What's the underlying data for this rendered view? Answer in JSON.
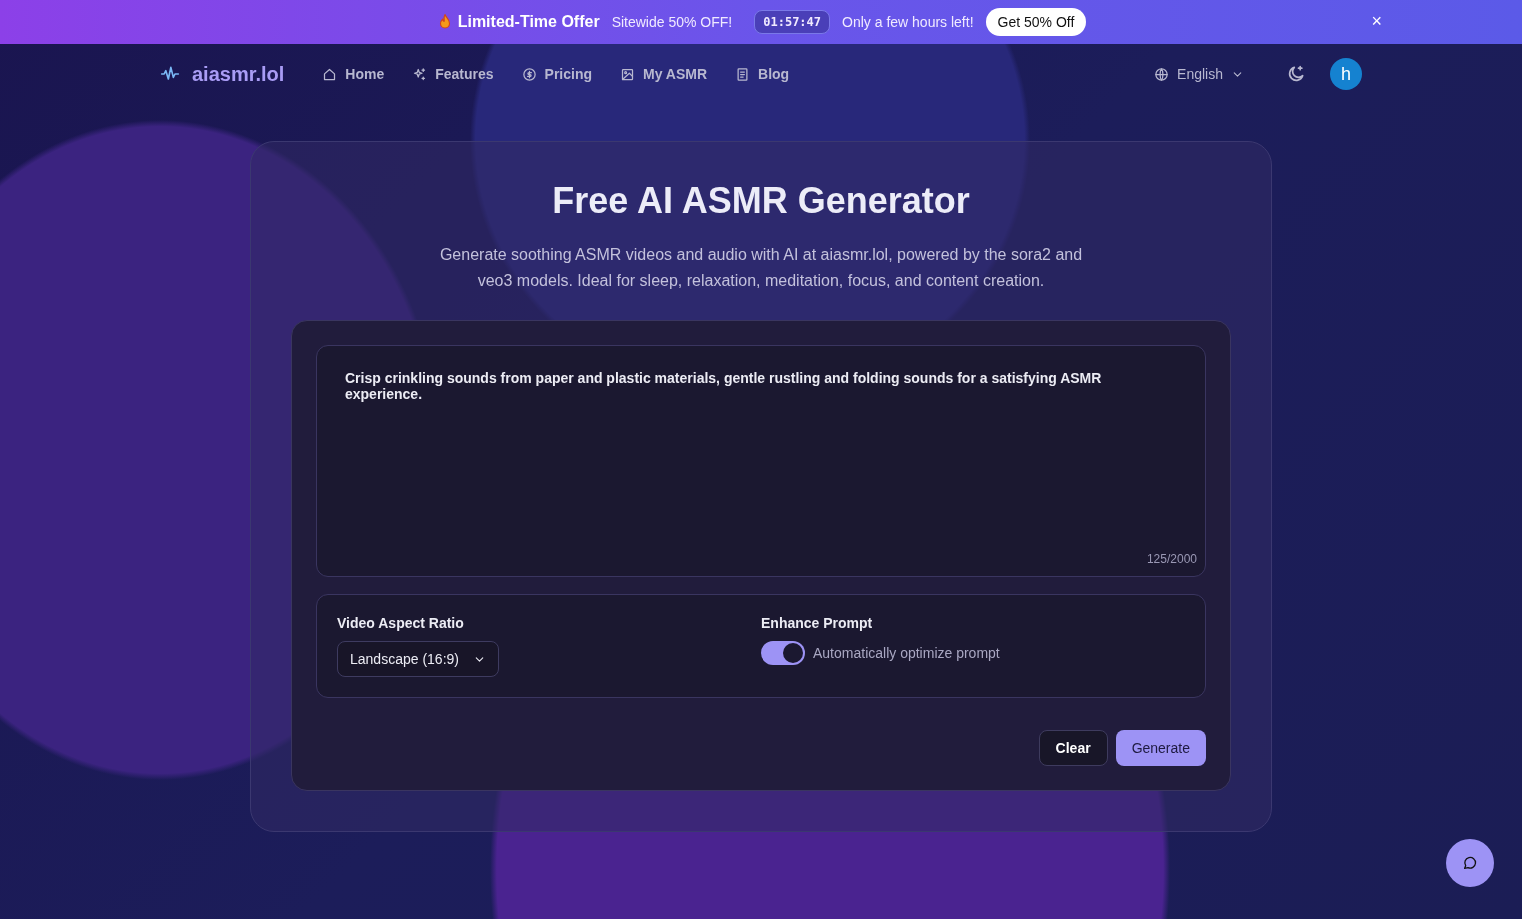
{
  "promo_banner": {
    "title": "Limited-Time Offer",
    "subtitle": "Sitewide 50% OFF!",
    "countdown": "01:57:47",
    "note": "Only a few hours left!",
    "cta": "Get 50% Off",
    "close": "×"
  },
  "nav": {
    "logo": "aiasmr.lol",
    "items": [
      {
        "label": "Home",
        "selected": false
      },
      {
        "label": "Features",
        "selected": false
      },
      {
        "label": "Pricing",
        "selected": false
      },
      {
        "label": "My ASMR",
        "selected": false
      },
      {
        "label": "Blog",
        "selected": false
      }
    ],
    "language": "English",
    "avatar": "h"
  },
  "hero": {
    "title": "Free AI ASMR Generator",
    "description": "Generate soothing ASMR videos and audio with AI at aiasmr.lol, powered by the sora2 and veo3 models. Ideal for sleep, relaxation, meditation, focus, and content creation."
  },
  "prompt": {
    "value": "Crisp crinkling sounds from paper and plastic materials, gentle rustling and folding sounds for a satisfying ASMR experience.",
    "counter": "125/2000"
  },
  "aspect_ratio": {
    "label": "Video Aspect Ratio",
    "value": "Landscape (16:9)"
  },
  "enhance": {
    "label": "Enhance Prompt",
    "toggle_label": "Automatically optimize prompt",
    "on": true
  },
  "buttons": {
    "clear": "Clear",
    "generate": "Generate"
  }
}
